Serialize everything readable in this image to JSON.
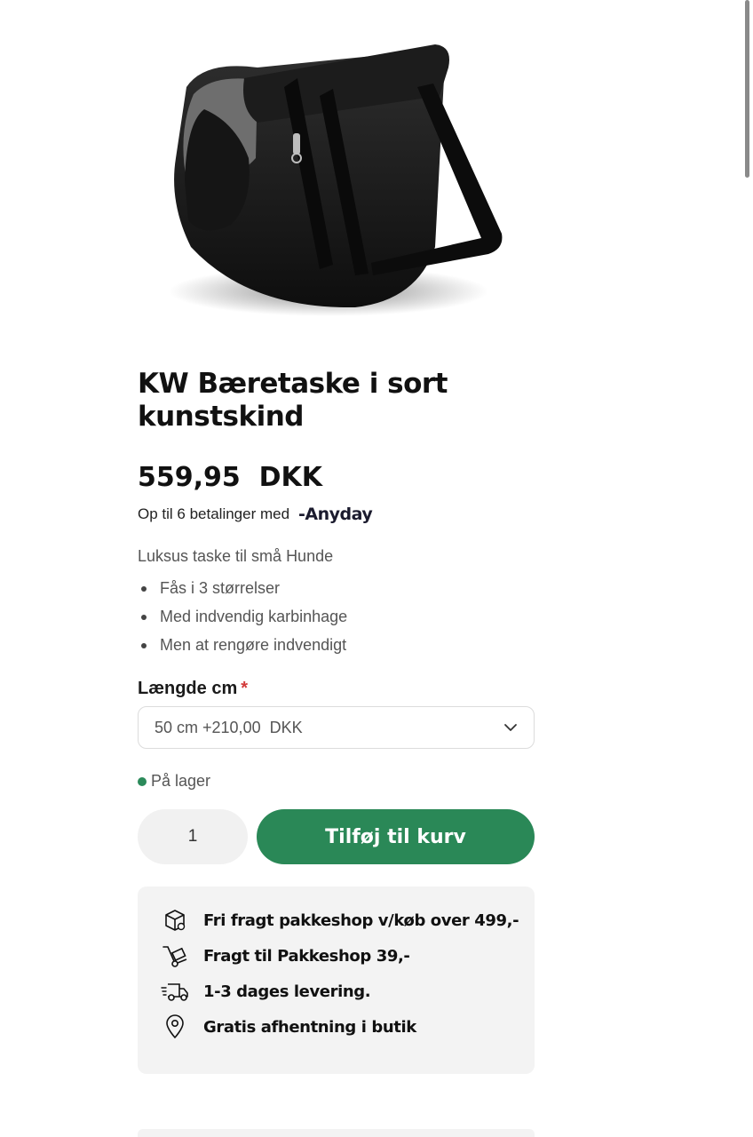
{
  "product": {
    "title": "KW Bæretaske i sort kunstskind",
    "price": "559,95  DKK",
    "installments_text": "Op til 6 betalinger med",
    "installments_provider": "-Anyday",
    "description": "Luksus taske til små Hunde",
    "features": [
      "Fås i 3 størrelser",
      "Med indvendig karbinhage",
      "Men at rengøre indvendigt"
    ]
  },
  "variant": {
    "label": "Længde cm",
    "required_mark": "*",
    "selected": "50 cm +210,00  DKK"
  },
  "stock": {
    "text": "På lager",
    "color": "#2b8a5a"
  },
  "cart": {
    "quantity": "1",
    "add_label": "Tilføj til kurv",
    "button_color": "#2a8857"
  },
  "shipping": {
    "items": [
      {
        "icon": "package-icon",
        "text": "Fri fragt pakkeshop v/køb over 499,-"
      },
      {
        "icon": "hand-truck-icon",
        "text": "Fragt til Pakkeshop 39,-"
      },
      {
        "icon": "delivery-truck-icon",
        "text": "1-3 dages levering."
      },
      {
        "icon": "location-pin-icon",
        "text": "Gratis afhentning i butik"
      }
    ]
  }
}
